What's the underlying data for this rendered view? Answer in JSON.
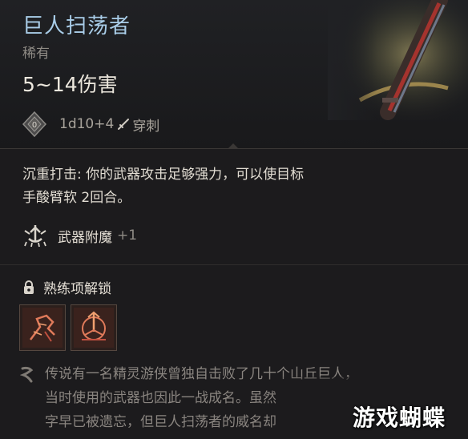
{
  "item": {
    "name": "巨人扫荡者",
    "rarity": "稀有",
    "damage": "5~14伤害",
    "dice": "1d10+4",
    "damage_type": "穿刺"
  },
  "ability": {
    "description_line1": "沉重打击: 你的武器攻击足够强力，可以使目标",
    "description_line2": "手酸臂软 2回合。"
  },
  "enchantment": {
    "label": "武器附魔",
    "value": "+1"
  },
  "proficiency": {
    "label": "熟练项解锁"
  },
  "lore": {
    "line1": "传说有一名精灵游侠曾独自击败了几十个山丘巨人，",
    "line2": "当时使用的武器也因此一战成名。虽然",
    "line3": "字早已被遗忘，但巨人扫荡者的威名却"
  },
  "watermark": "游戏蝴蝶",
  "colors": {
    "title": "#a9cde8",
    "background": "#1c1b1d",
    "lore_text": "#8a8580"
  },
  "icons": [
    "die-icon",
    "sword-icon",
    "enchant-icon",
    "lock-icon",
    "skill-icon-1",
    "skill-icon-2",
    "lore-icon"
  ]
}
